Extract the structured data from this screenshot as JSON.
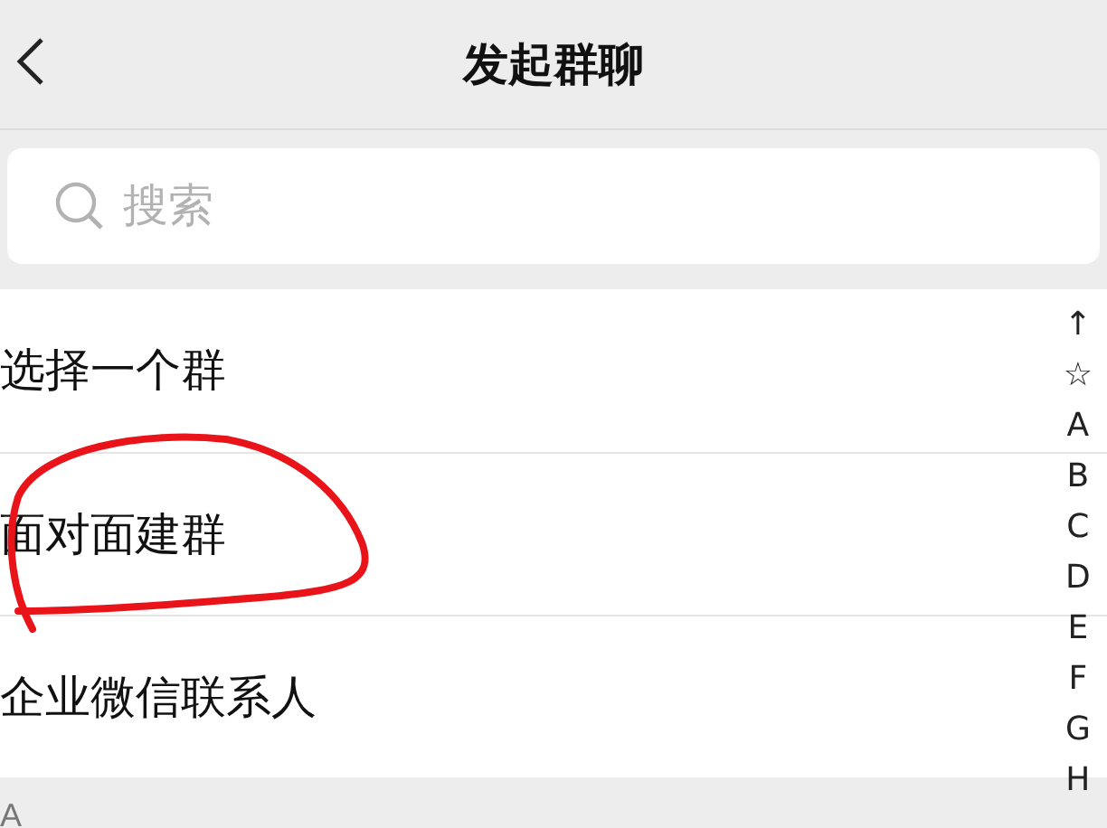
{
  "nav_bar": {
    "title": "发起群聊"
  },
  "search": {
    "placeholder": "搜索"
  },
  "items": [
    {
      "label": "选择一个群"
    },
    {
      "label": "面对面建群"
    },
    {
      "label": "企业微信联系人"
    }
  ],
  "section_header": "A",
  "index": [
    "↑",
    "☆",
    "A",
    "B",
    "C",
    "D",
    "E",
    "F",
    "G",
    "H"
  ]
}
